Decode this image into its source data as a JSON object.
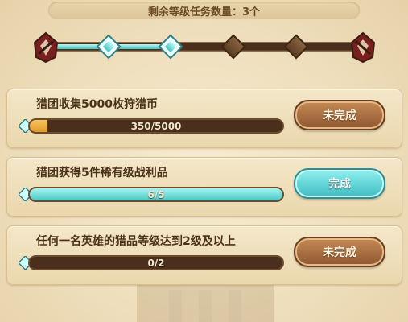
{
  "header": {
    "label": "剩余等级任务数量：",
    "remaining_count": "3个"
  },
  "level_track": {
    "nodes_total": 5,
    "nodes_completed": 3
  },
  "tasks": [
    {
      "title": "猎团收集5000枚狩猎币",
      "progress_text": "350/5000",
      "progress_fraction": 0.07,
      "bar_style": "gold",
      "button_label": "未完成",
      "button_style": "brown"
    },
    {
      "title": "猎团获得5件稀有级战利品",
      "progress_text": "6/5",
      "progress_fraction": 1.0,
      "bar_style": "cyan",
      "button_label": "完成",
      "button_style": "cyan"
    },
    {
      "title": "任何一名英雄的猎品等级达到2级及以上",
      "progress_text": "0/2",
      "progress_fraction": 0.0,
      "bar_style": "gold",
      "button_label": "未完成",
      "button_style": "brown"
    }
  ],
  "colors": {
    "accent_cyan": "#49c9c6",
    "bar_dark": "#4a2f1d",
    "gold_fill": "#e39a2a",
    "button_brown": "#8d5730"
  }
}
